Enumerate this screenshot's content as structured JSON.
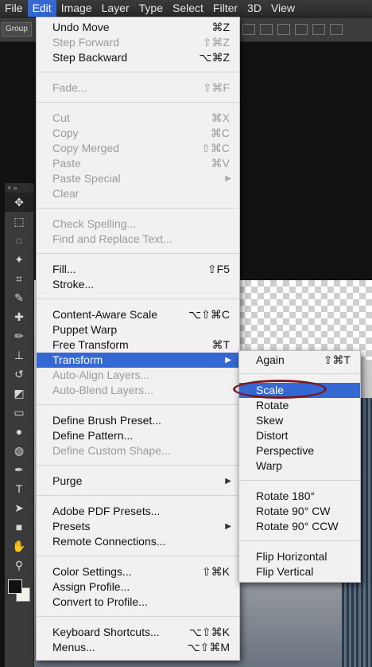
{
  "menubar": {
    "items": [
      "File",
      "Edit",
      "Image",
      "Layer",
      "Type",
      "Select",
      "Filter",
      "3D",
      "View"
    ],
    "active": "Edit"
  },
  "optionsbar": {
    "group_label": "Group"
  },
  "toolbox": {
    "header": "× »"
  },
  "edit_menu": {
    "items": [
      {
        "label": "Undo Move",
        "shortcut": "⌘Z"
      },
      {
        "label": "Step Forward",
        "shortcut": "⇧⌘Z",
        "disabled": true
      },
      {
        "label": "Step Backward",
        "shortcut": "⌥⌘Z"
      },
      {
        "label": "Fade...",
        "shortcut": "⇧⌘F",
        "disabled": true
      },
      {
        "label": "Cut",
        "shortcut": "⌘X",
        "disabled": true
      },
      {
        "label": "Copy",
        "shortcut": "⌘C",
        "disabled": true
      },
      {
        "label": "Copy Merged",
        "shortcut": "⇧⌘C",
        "disabled": true
      },
      {
        "label": "Paste",
        "shortcut": "⌘V",
        "disabled": true
      },
      {
        "label": "Paste Special",
        "shortcut": "",
        "disabled": true,
        "submenu": true
      },
      {
        "label": "Clear",
        "shortcut": "",
        "disabled": true
      },
      {
        "label": "Check Spelling...",
        "shortcut": "",
        "disabled": true
      },
      {
        "label": "Find and Replace Text...",
        "shortcut": "",
        "disabled": true
      },
      {
        "label": "Fill...",
        "shortcut": "⇧F5"
      },
      {
        "label": "Stroke...",
        "shortcut": ""
      },
      {
        "label": "Content-Aware Scale",
        "shortcut": "⌥⇧⌘C"
      },
      {
        "label": "Puppet Warp",
        "shortcut": ""
      },
      {
        "label": "Free Transform",
        "shortcut": "⌘T"
      },
      {
        "label": "Transform",
        "shortcut": "",
        "submenu": true,
        "highlighted": true
      },
      {
        "label": "Auto-Align Layers...",
        "shortcut": "",
        "disabled": true
      },
      {
        "label": "Auto-Blend Layers...",
        "shortcut": "",
        "disabled": true
      },
      {
        "label": "Define Brush Preset...",
        "shortcut": ""
      },
      {
        "label": "Define Pattern...",
        "shortcut": ""
      },
      {
        "label": "Define Custom Shape...",
        "shortcut": "",
        "disabled": true
      },
      {
        "label": "Purge",
        "shortcut": "",
        "submenu": true
      },
      {
        "label": "Adobe PDF Presets...",
        "shortcut": ""
      },
      {
        "label": "Presets",
        "shortcut": "",
        "submenu": true
      },
      {
        "label": "Remote Connections...",
        "shortcut": ""
      },
      {
        "label": "Color Settings...",
        "shortcut": "⇧⌘K"
      },
      {
        "label": "Assign Profile...",
        "shortcut": ""
      },
      {
        "label": "Convert to Profile...",
        "shortcut": ""
      },
      {
        "label": "Keyboard Shortcuts...",
        "shortcut": "⌥⇧⌘K"
      },
      {
        "label": "Menus...",
        "shortcut": "⌥⇧⌘M"
      }
    ]
  },
  "transform_submenu": {
    "items": [
      {
        "label": "Again",
        "shortcut": "⇧⌘T"
      },
      {
        "label": "Scale",
        "highlighted": true
      },
      {
        "label": "Rotate"
      },
      {
        "label": "Skew"
      },
      {
        "label": "Distort"
      },
      {
        "label": "Perspective"
      },
      {
        "label": "Warp"
      },
      {
        "label": "Rotate 180°"
      },
      {
        "label": "Rotate 90° CW"
      },
      {
        "label": "Rotate 90° CCW"
      },
      {
        "label": "Flip Horizontal"
      },
      {
        "label": "Flip Vertical"
      }
    ]
  },
  "colors": {
    "highlight": "#3469d3",
    "annotation": "#7a1a22"
  }
}
